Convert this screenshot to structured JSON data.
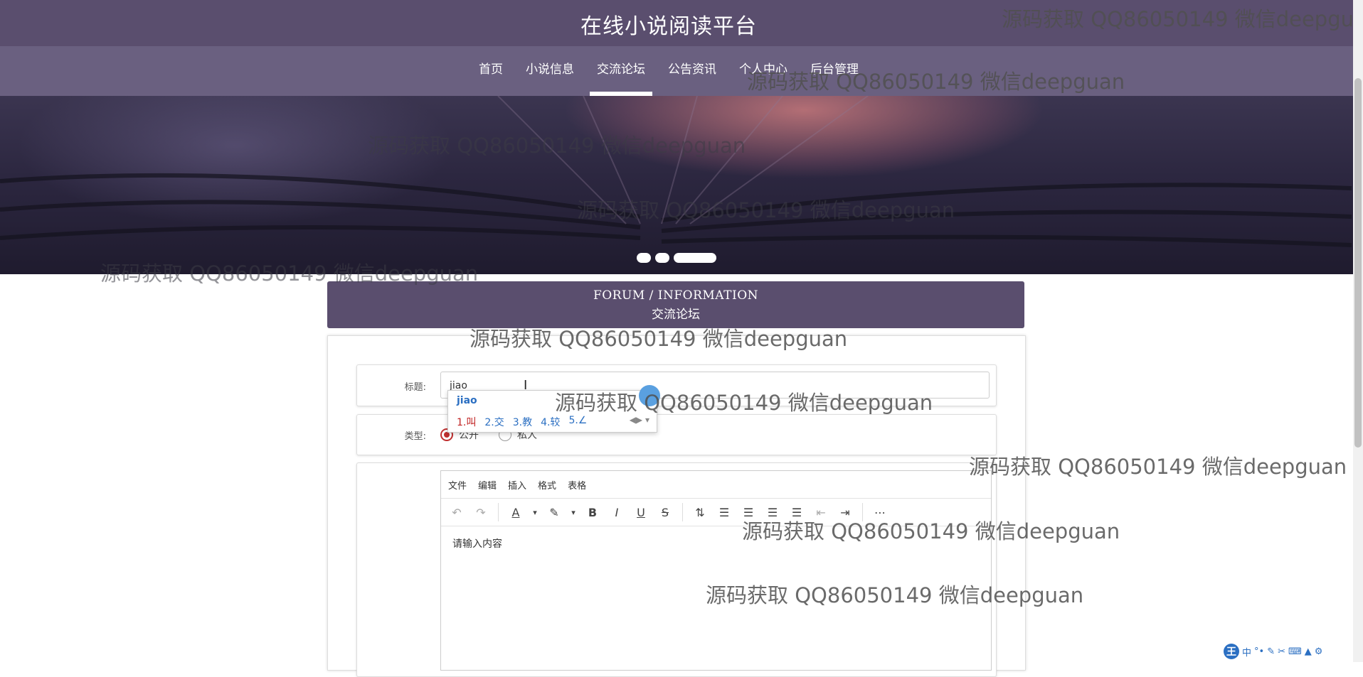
{
  "header": {
    "title": "在线小说阅读平台"
  },
  "nav": {
    "items": [
      {
        "label": "首页",
        "active": false
      },
      {
        "label": "小说信息",
        "active": false
      },
      {
        "label": "交流论坛",
        "active": true
      },
      {
        "label": "公告资讯",
        "active": false
      },
      {
        "label": "个人中心",
        "active": false
      },
      {
        "label": "后台管理",
        "active": false
      }
    ]
  },
  "banner": {
    "carousel_dots": 3,
    "active_dot": 3
  },
  "forum": {
    "heading_en": "FORUM / INFORMATION",
    "heading_cn": "交流论坛"
  },
  "form": {
    "title_label": "标题:",
    "title_value": "jiao",
    "type_label": "类型:",
    "type_options": [
      {
        "label": "公开",
        "checked": true
      },
      {
        "label": "私人",
        "checked": false
      }
    ],
    "editor": {
      "menu": [
        "文件",
        "编辑",
        "插入",
        "格式",
        "表格"
      ],
      "toolbar_icons": [
        "undo-icon",
        "redo-icon",
        "text-color-icon",
        "highlight-color-icon",
        "bold-icon",
        "italic-icon",
        "underline-icon",
        "strikethrough-icon",
        "line-height-icon",
        "align-left-icon",
        "align-center-icon",
        "align-right-icon",
        "align-justify-icon",
        "outdent-icon",
        "indent-icon",
        "more-icon"
      ],
      "placeholder": "请输入内容"
    }
  },
  "ime": {
    "composition": "jiao",
    "candidates": [
      "1.叫",
      "2.交",
      "3.教",
      "4.较",
      "5.∠"
    ],
    "status": "中"
  },
  "watermarks": {
    "text": "源码获取 QQ86050149 微信deepguan",
    "clipped_text": "源码获取 QQ86050149 微信deepgua"
  }
}
